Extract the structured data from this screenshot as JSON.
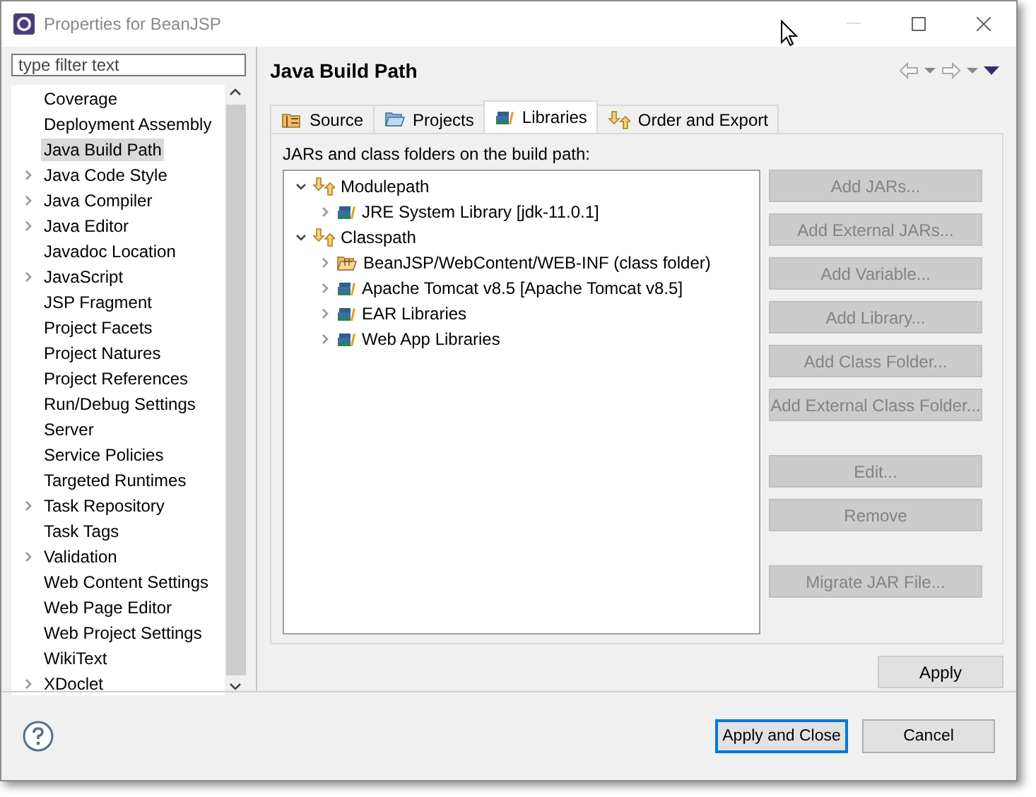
{
  "window": {
    "title": "Properties for BeanJSP"
  },
  "filter": {
    "placeholder": "type filter text"
  },
  "sidebar": {
    "items": [
      {
        "label": "Coverage",
        "expandable": false,
        "selected": false
      },
      {
        "label": "Deployment Assembly",
        "expandable": false,
        "selected": false
      },
      {
        "label": "Java Build Path",
        "expandable": false,
        "selected": true
      },
      {
        "label": "Java Code Style",
        "expandable": true,
        "selected": false
      },
      {
        "label": "Java Compiler",
        "expandable": true,
        "selected": false
      },
      {
        "label": "Java Editor",
        "expandable": true,
        "selected": false
      },
      {
        "label": "Javadoc Location",
        "expandable": false,
        "selected": false
      },
      {
        "label": "JavaScript",
        "expandable": true,
        "selected": false
      },
      {
        "label": "JSP Fragment",
        "expandable": false,
        "selected": false
      },
      {
        "label": "Project Facets",
        "expandable": false,
        "selected": false
      },
      {
        "label": "Project Natures",
        "expandable": false,
        "selected": false
      },
      {
        "label": "Project References",
        "expandable": false,
        "selected": false
      },
      {
        "label": "Run/Debug Settings",
        "expandable": false,
        "selected": false
      },
      {
        "label": "Server",
        "expandable": false,
        "selected": false
      },
      {
        "label": "Service Policies",
        "expandable": false,
        "selected": false
      },
      {
        "label": "Targeted Runtimes",
        "expandable": false,
        "selected": false
      },
      {
        "label": "Task Repository",
        "expandable": true,
        "selected": false
      },
      {
        "label": "Task Tags",
        "expandable": false,
        "selected": false
      },
      {
        "label": "Validation",
        "expandable": true,
        "selected": false
      },
      {
        "label": "Web Content Settings",
        "expandable": false,
        "selected": false
      },
      {
        "label": "Web Page Editor",
        "expandable": false,
        "selected": false
      },
      {
        "label": "Web Project Settings",
        "expandable": false,
        "selected": false
      },
      {
        "label": "WikiText",
        "expandable": false,
        "selected": false
      },
      {
        "label": "XDoclet",
        "expandable": true,
        "selected": false
      }
    ]
  },
  "page": {
    "title": "Java Build Path",
    "tabs": [
      {
        "label": "Source",
        "kind": "source",
        "selected": false
      },
      {
        "label": "Projects",
        "kind": "projects",
        "selected": false
      },
      {
        "label": "Libraries",
        "kind": "libraries",
        "selected": true
      },
      {
        "label": "Order and Export",
        "kind": "order",
        "selected": false
      }
    ],
    "list_label": "JARs and class folders on the build path:",
    "tree": [
      {
        "label": "Modulepath",
        "kind": "category",
        "expanded": true,
        "children": [
          {
            "label": "JRE System Library [jdk-11.0.1]",
            "kind": "library",
            "expanded": false
          }
        ]
      },
      {
        "label": "Classpath",
        "kind": "category",
        "expanded": true,
        "children": [
          {
            "label": "BeanJSP/WebContent/WEB-INF (class folder)",
            "kind": "folder",
            "expanded": false
          },
          {
            "label": "Apache Tomcat v8.5 [Apache Tomcat v8.5]",
            "kind": "library",
            "expanded": false
          },
          {
            "label": "EAR Libraries",
            "kind": "library",
            "expanded": false
          },
          {
            "label": "Web App Libraries",
            "kind": "library",
            "expanded": false
          }
        ]
      }
    ],
    "button_groups": [
      [
        {
          "label": "Add JARs...",
          "disabled": true
        },
        {
          "label": "Add External JARs...",
          "disabled": true
        },
        {
          "label": "Add Variable...",
          "disabled": true
        },
        {
          "label": "Add Library...",
          "disabled": true
        },
        {
          "label": "Add Class Folder...",
          "disabled": true
        },
        {
          "label": "Add External Class Folder...",
          "disabled": true
        }
      ],
      [
        {
          "label": "Edit...",
          "disabled": true
        },
        {
          "label": "Remove",
          "disabled": true
        }
      ],
      [
        {
          "label": "Migrate JAR File...",
          "disabled": true
        }
      ]
    ],
    "apply": {
      "label": "Apply",
      "disabled": false
    }
  },
  "footer": {
    "buttons": [
      {
        "label": "Apply and Close",
        "default": true
      },
      {
        "label": "Cancel",
        "default": false
      }
    ]
  }
}
